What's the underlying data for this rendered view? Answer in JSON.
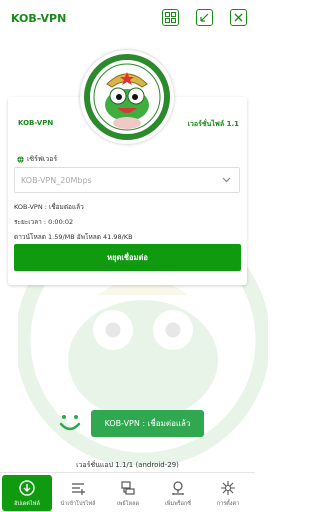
{
  "app": {
    "title": "KOB-VPN"
  },
  "card": {
    "left_label": "KOB-VPN",
    "right_label": "เวอร์ชั่นไฟล์ 1.1"
  },
  "server": {
    "label": "เซิร์ฟเวอร์",
    "selected": "KOB-VPN_20Mbps"
  },
  "info": {
    "line1": "KOB-VPN : เชื่อมต่อแล้ว",
    "line2": "ระยะเวลา : 0:00:02",
    "line3": "ดาวน์โหลด 1.59/MB อัพโหลด 41.98/KB"
  },
  "disconnect_label": "หยุดเชื่อมต่อ",
  "status": {
    "text": "KOB-VPN : เชื่อมต่อแล้ว"
  },
  "version": "เวอร์ชั่นแอป 1.1/1 (android-29)",
  "nav": [
    {
      "label": "อัปเดตไฟล์",
      "icon": "download-icon",
      "active": true
    },
    {
      "label": "นำเข้าโปรไฟล์",
      "icon": "import-icon",
      "active": false
    },
    {
      "label": "เพย์โหลด",
      "icon": "payload-icon",
      "active": false
    },
    {
      "label": "เพิ่มพร็อกซี่",
      "icon": "proxy-icon",
      "active": false
    },
    {
      "label": "การตั้งค่า",
      "icon": "settings-icon",
      "active": false
    }
  ],
  "colors": {
    "accent": "#109a10",
    "status": "#2fa84f"
  }
}
